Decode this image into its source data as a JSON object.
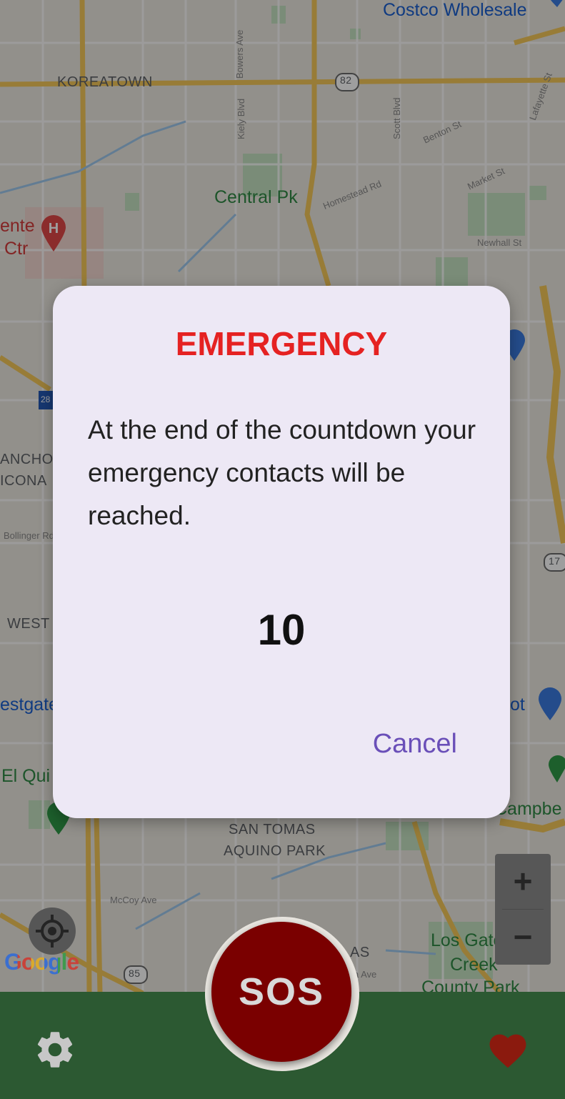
{
  "map": {
    "labels": {
      "costco": "Costco Wholesale",
      "koreatown": "KOREATOWN",
      "central_park": "Central Pk",
      "hospital_a": "ente",
      "hospital_b": "Ctr",
      "rancho_a": "ANCHO",
      "rancho_b": "ICONA",
      "west": "WEST",
      "westgate": "estgate",
      "el_quito": "El Qui",
      "campbell": "Campbe",
      "target": "ot",
      "san_tomas_a": "SAN TOMAS",
      "san_tomas_b": "AQUINO PARK",
      "los_gatos_a": "Los Gatos",
      "los_gatos_b": "Creek",
      "los_gatos_c": "County Park",
      "bowers": "Bowers Ave",
      "kiely": "Kiely Blvd",
      "scott": "Scott Blvd",
      "benton": "Benton St",
      "lafayette": "Lafayette St",
      "homestead": "Homestead Rd",
      "market": "Market St",
      "newhall": "Newhall St",
      "bollinger": "Bollinger Rd",
      "mccoy": "McCoy Ave",
      "route_82": "82",
      "route_85": "85",
      "route_17": "17",
      "route_280": "28",
      "ras": "AS",
      "hwy_ave": "a Ave"
    },
    "google_logo": "Google",
    "zoom_in": "+",
    "zoom_out": "−"
  },
  "dialog": {
    "title": "EMERGENCY",
    "message": "At the end of the countdown your emergency contacts will be reached.",
    "countdown": "10",
    "cancel_label": "Cancel"
  },
  "bottom_bar": {
    "sos_label": "SOS",
    "settings_icon": "gear-icon",
    "favorites_icon": "heart-icon"
  },
  "colors": {
    "title_red": "#e52222",
    "cancel_purple": "#6a4fb8",
    "bar_green": "#2c5932",
    "sos_red": "#7a0000",
    "heart_red": "#8b1a0e"
  }
}
